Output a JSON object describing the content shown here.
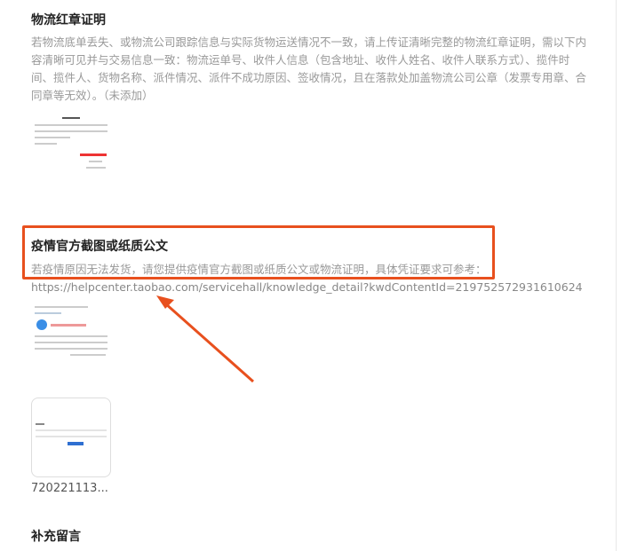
{
  "sections": [
    {
      "title": "物流红章证明",
      "desc": "若物流底单丢失、或物流公司跟踪信息与实际货物运送情况不一致，请上传证清晰完整的物流红章证明，需以下内容清晰可见并与交易信息一致：物流运单号、收件人信息（包含地址、收件人姓名、收件人联系方式）、揽件时间、揽件人、货物名称、派件情况、派件不成功原因、签收情况，且在落款处加盖物流公司公章（发票专用章、合同章等无效）。（未添加）"
    },
    {
      "title": "疫情官方截图或纸质公文",
      "desc": "若疫情原因无法发货，请您提供疫情官方截图或纸质公文或物流证明，具体凭证要求可参考：",
      "link": "https://helpcenter.taobao.com/servicehall/knowledge_detail?kwdContentId=219752572931610624",
      "file_caption": "720221113..."
    },
    {
      "title": "补充留言"
    }
  ],
  "colors": {
    "highlight": "#e8501e"
  }
}
